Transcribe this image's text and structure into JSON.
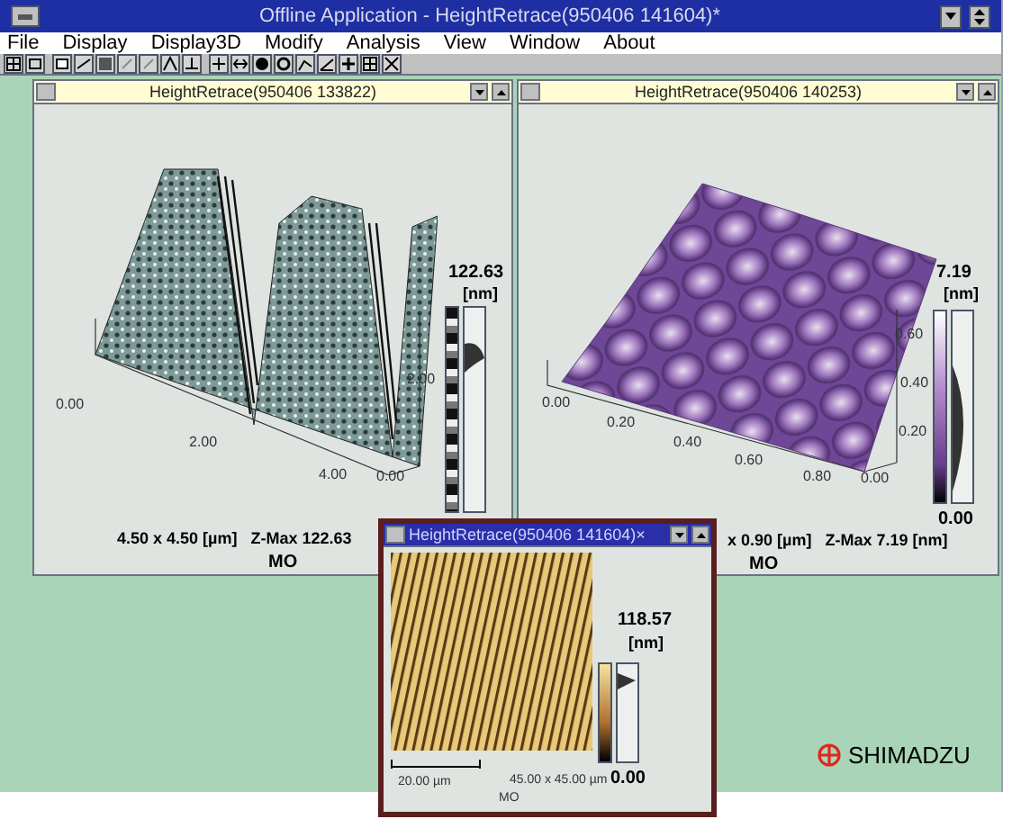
{
  "window": {
    "title": "Offline Application - HeightRetrace(950406 141604)*"
  },
  "menu": [
    "File",
    "Display",
    "Display3D",
    "Modify",
    "Analysis",
    "View",
    "Window",
    "About"
  ],
  "child_windows": [
    {
      "kind": "ridges",
      "title": "HeightRetrace(950406 133822)",
      "selected": false,
      "z_max": "122.63",
      "unit": "[nm]",
      "y_ticks": [
        "2.00"
      ],
      "x_ticks": [
        "0.00",
        "2.00",
        "4.00"
      ],
      "corner": "0.00",
      "footer": "4.50 x 4.50 [µm]   Z-Max 122.63",
      "mode": "MO"
    },
    {
      "kind": "grains",
      "title": "HeightRetrace(950406 140253)",
      "selected": false,
      "z_max": "7.19",
      "unit": "[nm]",
      "y_ticks": [
        "0.60",
        "0.40",
        "0.20"
      ],
      "x_ticks": [
        "0.00",
        "0.20",
        "0.40",
        "0.60",
        "0.80"
      ],
      "corner": "0.00",
      "scale_min": "0.00",
      "footer": "x 0.90 [µm]   Z-Max 7.19 [nm]",
      "mode": "MO"
    },
    {
      "kind": "stripes",
      "title": "HeightRetrace(950406 141604)×",
      "selected": true,
      "z_max": "118.57",
      "unit": "[nm]",
      "scale_min": "0.00",
      "scale_bar": "20.00 µm",
      "size": "45.00 x 45.00 µm",
      "mode": "MO"
    }
  ],
  "logo": {
    "text": "SHIMADZU"
  }
}
